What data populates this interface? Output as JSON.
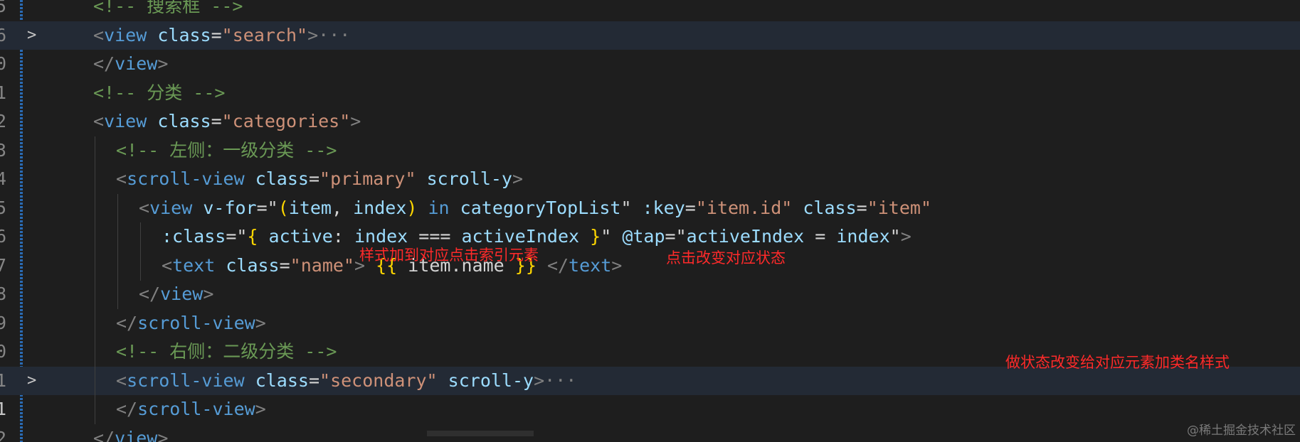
{
  "editor": {
    "lines": [
      {
        "num": "5",
        "fold": "",
        "indent": 0,
        "highlight": false,
        "tokens": [
          {
            "t": "<!-- 搜索框 -->",
            "c": "comment"
          }
        ]
      },
      {
        "num": "6",
        "fold": ">",
        "indent": 0,
        "highlight": true,
        "tokens": [
          {
            "t": "<",
            "c": "punct"
          },
          {
            "t": "view",
            "c": "tag"
          },
          {
            "t": " ",
            "c": "plain"
          },
          {
            "t": "class",
            "c": "attr"
          },
          {
            "t": "=",
            "c": "plain"
          },
          {
            "t": "\"search\"",
            "c": "str"
          },
          {
            "t": ">",
            "c": "punct"
          },
          {
            "t": "···",
            "c": "fold"
          }
        ]
      },
      {
        "num": "0",
        "fold": "",
        "indent": 0,
        "highlight": false,
        "tokens": [
          {
            "t": "</",
            "c": "punct"
          },
          {
            "t": "view",
            "c": "tag"
          },
          {
            "t": ">",
            "c": "punct"
          }
        ]
      },
      {
        "num": "1",
        "fold": "",
        "indent": 0,
        "highlight": false,
        "tokens": [
          {
            "t": "<!-- 分类 -->",
            "c": "comment"
          }
        ]
      },
      {
        "num": "2",
        "fold": "",
        "indent": 0,
        "highlight": false,
        "tokens": [
          {
            "t": "<",
            "c": "punct"
          },
          {
            "t": "view",
            "c": "tag"
          },
          {
            "t": " ",
            "c": "plain"
          },
          {
            "t": "class",
            "c": "attr"
          },
          {
            "t": "=",
            "c": "plain"
          },
          {
            "t": "\"categories\"",
            "c": "str"
          },
          {
            "t": ">",
            "c": "punct"
          }
        ]
      },
      {
        "num": "3",
        "fold": "",
        "indent": 1,
        "highlight": false,
        "tokens": [
          {
            "t": "<!-- 左侧：一级分类 -->",
            "c": "comment"
          }
        ]
      },
      {
        "num": "4",
        "fold": "",
        "indent": 1,
        "highlight": false,
        "tokens": [
          {
            "t": "<",
            "c": "punct"
          },
          {
            "t": "scroll-view",
            "c": "tag"
          },
          {
            "t": " ",
            "c": "plain"
          },
          {
            "t": "class",
            "c": "attr"
          },
          {
            "t": "=",
            "c": "plain"
          },
          {
            "t": "\"primary\"",
            "c": "str"
          },
          {
            "t": " ",
            "c": "plain"
          },
          {
            "t": "scroll-y",
            "c": "attr"
          },
          {
            "t": ">",
            "c": "punct"
          }
        ]
      },
      {
        "num": "5",
        "fold": "",
        "indent": 2,
        "highlight": false,
        "tokens": [
          {
            "t": "<",
            "c": "punct"
          },
          {
            "t": "view",
            "c": "tag"
          },
          {
            "t": " ",
            "c": "plain"
          },
          {
            "t": "v-for",
            "c": "attr"
          },
          {
            "t": "=\"",
            "c": "plain"
          },
          {
            "t": "(",
            "c": "brace"
          },
          {
            "t": "item",
            "c": "attr"
          },
          {
            "t": ", ",
            "c": "plain"
          },
          {
            "t": "index",
            "c": "attr"
          },
          {
            "t": ")",
            "c": "brace"
          },
          {
            "t": " ",
            "c": "plain"
          },
          {
            "t": "in",
            "c": "kw"
          },
          {
            "t": " ",
            "c": "plain"
          },
          {
            "t": "categoryTopList",
            "c": "attr"
          },
          {
            "t": "\" ",
            "c": "plain"
          },
          {
            "t": ":key",
            "c": "attr"
          },
          {
            "t": "=",
            "c": "plain"
          },
          {
            "t": "\"item.id\"",
            "c": "str"
          },
          {
            "t": " ",
            "c": "plain"
          },
          {
            "t": "class",
            "c": "attr"
          },
          {
            "t": "=",
            "c": "plain"
          },
          {
            "t": "\"item\"",
            "c": "str"
          }
        ]
      },
      {
        "num": "6",
        "fold": "",
        "indent": 3,
        "highlight": false,
        "tokens": [
          {
            "t": ":class",
            "c": "attr"
          },
          {
            "t": "=\"",
            "c": "plain"
          },
          {
            "t": "{",
            "c": "brace"
          },
          {
            "t": " ",
            "c": "plain"
          },
          {
            "t": "active",
            "c": "attr"
          },
          {
            "t": ": ",
            "c": "plain"
          },
          {
            "t": "index",
            "c": "attr"
          },
          {
            "t": " === ",
            "c": "plain"
          },
          {
            "t": "activeIndex",
            "c": "attr"
          },
          {
            "t": " ",
            "c": "plain"
          },
          {
            "t": "}",
            "c": "brace"
          },
          {
            "t": "\" ",
            "c": "plain"
          },
          {
            "t": "@tap",
            "c": "attr"
          },
          {
            "t": "=\"",
            "c": "plain"
          },
          {
            "t": "activeIndex",
            "c": "attr"
          },
          {
            "t": " = ",
            "c": "plain"
          },
          {
            "t": "index",
            "c": "attr"
          },
          {
            "t": "\"",
            "c": "plain"
          },
          {
            "t": ">",
            "c": "punct"
          }
        ]
      },
      {
        "num": "7",
        "fold": "",
        "indent": 3,
        "highlight": false,
        "tokens": [
          {
            "t": "<",
            "c": "punct"
          },
          {
            "t": "text",
            "c": "tag"
          },
          {
            "t": " ",
            "c": "plain"
          },
          {
            "t": "class",
            "c": "attr"
          },
          {
            "t": "=",
            "c": "plain"
          },
          {
            "t": "\"name\"",
            "c": "str"
          },
          {
            "t": "> ",
            "c": "punct"
          },
          {
            "t": "{{",
            "c": "brace"
          },
          {
            "t": " item.name ",
            "c": "plain"
          },
          {
            "t": "}}",
            "c": "brace"
          },
          {
            "t": " </",
            "c": "punct"
          },
          {
            "t": "text",
            "c": "tag"
          },
          {
            "t": ">",
            "c": "punct"
          }
        ]
      },
      {
        "num": "8",
        "fold": "",
        "indent": 2,
        "highlight": false,
        "tokens": [
          {
            "t": "</",
            "c": "punct"
          },
          {
            "t": "view",
            "c": "tag"
          },
          {
            "t": ">",
            "c": "punct"
          }
        ]
      },
      {
        "num": "9",
        "fold": "",
        "indent": 1,
        "highlight": false,
        "tokens": [
          {
            "t": "</",
            "c": "punct"
          },
          {
            "t": "scroll-view",
            "c": "tag"
          },
          {
            "t": ">",
            "c": "punct"
          }
        ]
      },
      {
        "num": "0",
        "fold": "",
        "indent": 1,
        "highlight": false,
        "tokens": [
          {
            "t": "<!-- 右侧：二级分类 -->",
            "c": "comment"
          }
        ]
      },
      {
        "num": "1",
        "fold": ">",
        "indent": 1,
        "highlight": true,
        "tokens": [
          {
            "t": "<",
            "c": "punct"
          },
          {
            "t": "scroll-view",
            "c": "tag"
          },
          {
            "t": " ",
            "c": "plain"
          },
          {
            "t": "class",
            "c": "attr"
          },
          {
            "t": "=",
            "c": "plain"
          },
          {
            "t": "\"secondary\"",
            "c": "str"
          },
          {
            "t": " ",
            "c": "plain"
          },
          {
            "t": "scroll-y",
            "c": "attr"
          },
          {
            "t": ">",
            "c": "punct"
          },
          {
            "t": "···",
            "c": "fold"
          }
        ]
      },
      {
        "num": "1",
        "fold": "",
        "indent": 1,
        "highlight": false,
        "current": true,
        "tokens": [
          {
            "t": "</",
            "c": "punct"
          },
          {
            "t": "scroll-view",
            "c": "tag"
          },
          {
            "t": ">",
            "c": "punct"
          }
        ]
      },
      {
        "num": "2",
        "fold": "",
        "indent": 0,
        "highlight": false,
        "tokens": [
          {
            "t": "</",
            "c": "punct"
          },
          {
            "t": "view",
            "c": "tag"
          },
          {
            "t": ">",
            "c": "punct"
          }
        ]
      }
    ]
  },
  "annotations": {
    "style_to_index": "样式加到对应点击索引元素",
    "click_change_state": "点击改变对应状态",
    "state_change_class": "做状态改变给对应元素加类名样式"
  },
  "annotation_color": "#ff2a2a",
  "watermark": "@稀土掘金技术社区"
}
